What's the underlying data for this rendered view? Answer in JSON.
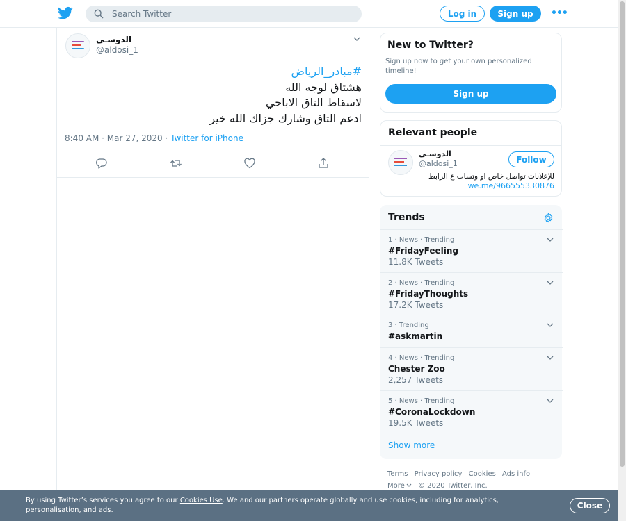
{
  "header": {
    "search_placeholder": "Search Twitter",
    "login_label": "Log in",
    "signup_label": "Sign up",
    "more_label": "•••"
  },
  "tweet": {
    "author_name": "الدوسـي",
    "author_handle": "@aldosi_1",
    "hashtag": "#مبادر_الرياض",
    "lines": [
      "هشتاق لوجه الله",
      "لاسقاط التاق الاباحي",
      "ادعم التاق وشارك جزاك الله خير"
    ],
    "time": "8:40 AM · Mar 27, 2020 · ",
    "source": "Twitter for iPhone"
  },
  "new_to_twitter": {
    "title": "New to Twitter?",
    "description": "Sign up now to get your own personalized timeline!",
    "button": "Sign up"
  },
  "relevant_people": {
    "title": "Relevant people",
    "name": "الدوسـي",
    "handle": "@aldosi_1",
    "follow_label": "Follow",
    "bio": "للإعلانات تواصل خاص او وتساب ع الرابط",
    "bio_link": "we.me/966555330876"
  },
  "trends": {
    "title": "Trends",
    "items": [
      {
        "meta": "1 · News · Trending",
        "name": "#FridayFeeling",
        "count": "11.8K Tweets"
      },
      {
        "meta": "2 · News · Trending",
        "name": "#FridayThoughts",
        "count": "17.2K Tweets"
      },
      {
        "meta": "3 · Trending",
        "name": "#askmartin",
        "count": ""
      },
      {
        "meta": "4 · News · Trending",
        "name": "Chester Zoo",
        "count": "2,257 Tweets"
      },
      {
        "meta": "5 · News · Trending",
        "name": "#CoronaLockdown",
        "count": "19.5K Tweets"
      }
    ],
    "show_more": "Show more"
  },
  "footer": {
    "links": [
      "Terms",
      "Privacy policy",
      "Cookies",
      "Ads info"
    ],
    "more": "More",
    "copyright": "© 2020 Twitter, Inc."
  },
  "cookie_banner": {
    "text_before": "By using Twitter’s services you agree to our ",
    "link": "Cookies Use",
    "text_after": ". We and our partners operate globally and use cookies, including for analytics, personalisation, and ads.",
    "close_label": "Close"
  },
  "colors": {
    "accent": "#1da1f2",
    "text": "#14171a",
    "muted": "#657786",
    "banner": "#5b7083"
  }
}
